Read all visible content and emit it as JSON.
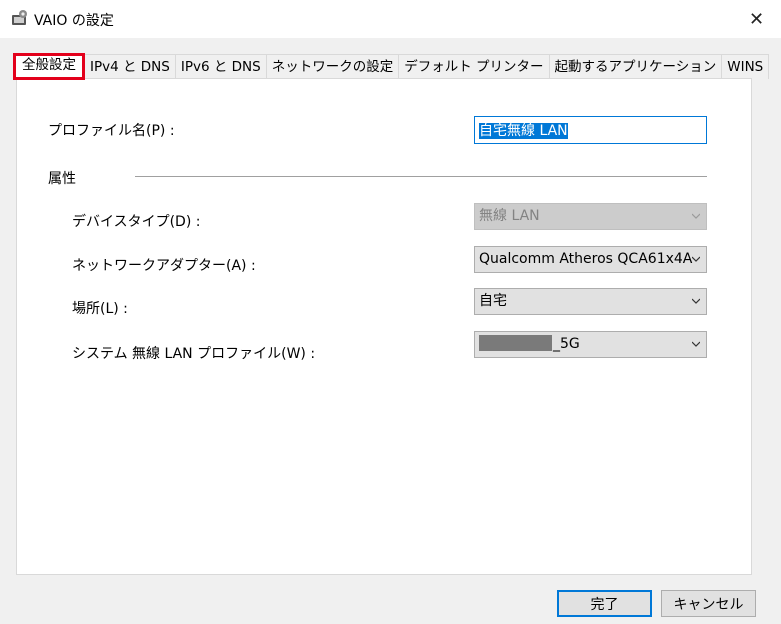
{
  "window": {
    "title": "VAIO の設定",
    "close_glyph": "✕"
  },
  "tabs": [
    {
      "label": "全般設定",
      "active": true
    },
    {
      "label": "IPv4 と DNS"
    },
    {
      "label": "IPv6 と DNS"
    },
    {
      "label": "ネットワークの設定"
    },
    {
      "label": "デフォルト プリンター"
    },
    {
      "label": "起動するアプリケーション"
    },
    {
      "label": "WINS"
    }
  ],
  "general": {
    "profile_name_label": "プロファイル名(P) :",
    "profile_name_value": "自宅無線 LAN",
    "attributes_heading": "属性",
    "device_type_label": "デバイスタイプ(D) :",
    "device_type_value": "無線 LAN",
    "adapter_label": "ネットワークアダプター(A) :",
    "adapter_value": "Qualcomm Atheros QCA61x4A",
    "location_label": "場所(L) :",
    "location_value": "自宅",
    "wlan_profile_label": "システム 無線 LAN プロファイル(W) :",
    "wlan_profile_value_suffix": "_5G"
  },
  "buttons": {
    "ok": "完了",
    "cancel": "キャンセル"
  },
  "colors": {
    "highlight_border": "#e3001b",
    "selection": "#0078d7"
  },
  "icons": {
    "app": "vaio-settings-icon",
    "dropdown": "chevron-down-icon",
    "close": "close-icon"
  }
}
